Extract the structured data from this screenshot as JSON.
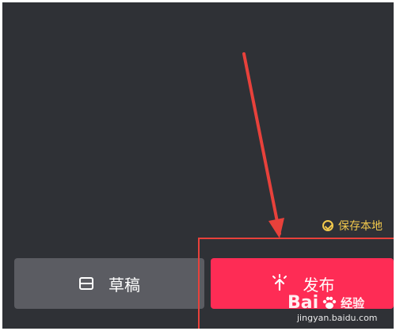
{
  "status": {
    "saved_text": "保存本地"
  },
  "buttons": {
    "draft_label": "草稿",
    "publish_label": "发布"
  },
  "watermark": {
    "brand_left": "Bai",
    "brand_right": "经验",
    "site": "jingyan.baidu.com"
  },
  "colors": {
    "background": "#2f3136",
    "draft_button": "#5b5c62",
    "publish_button": "#fe2c55",
    "annotation": "#e8413b",
    "hint": "#f2c94c"
  },
  "icons": {
    "saved": "check-circle-icon",
    "draft": "draft-box-icon",
    "publish": "upload-arrow-icon",
    "watermark": "paw-icon"
  }
}
